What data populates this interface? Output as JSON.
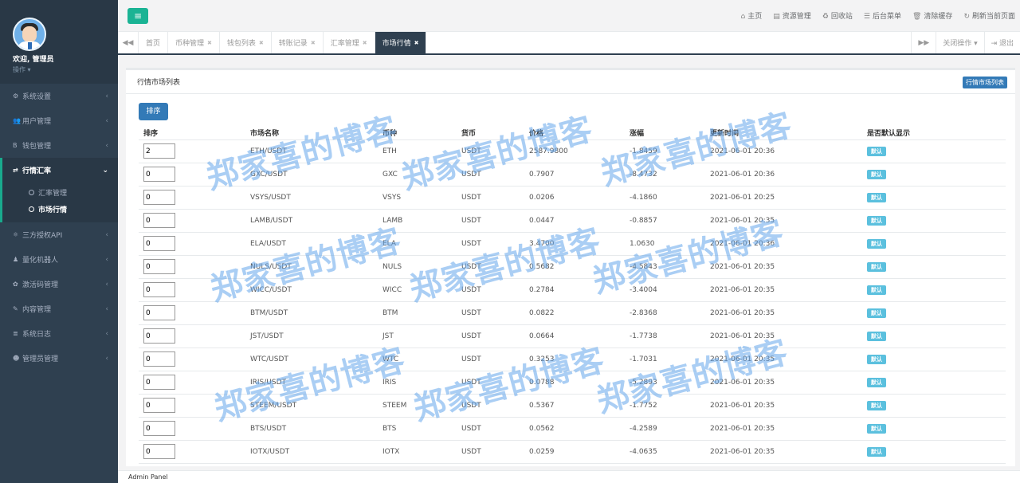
{
  "sidebar": {
    "welcome": "欢迎, 管理员",
    "ops": "操作 ▾",
    "items": [
      {
        "icon": "⚙",
        "label": "系统设置"
      },
      {
        "icon": "👥",
        "label": "用户管理"
      },
      {
        "icon": "B",
        "label": "钱包管理"
      },
      {
        "icon": "⇄",
        "label": "行情汇率"
      },
      {
        "icon": "⚛",
        "label": "三方授权API"
      },
      {
        "icon": "♟",
        "label": "量化机器人"
      },
      {
        "icon": "✿",
        "label": "激活码管理"
      },
      {
        "icon": "✎",
        "label": "内容管理"
      },
      {
        "icon": "≣",
        "label": "系统日志"
      },
      {
        "icon": "☻",
        "label": "管理员管理"
      }
    ],
    "sub_items": [
      {
        "label": "汇率管理"
      },
      {
        "label": "市场行情"
      }
    ]
  },
  "topbar": {
    "links": [
      {
        "icon": "⌂",
        "label": "主页"
      },
      {
        "icon": "▤",
        "label": "资源管理"
      },
      {
        "icon": "♻",
        "label": "回收站"
      },
      {
        "icon": "☰",
        "label": "后台菜单"
      },
      {
        "icon": "🗑",
        "label": "清除缓存"
      },
      {
        "icon": "↻",
        "label": "刷新当前页面"
      }
    ]
  },
  "tabs": {
    "items": [
      {
        "label": "首页"
      },
      {
        "label": "币种管理"
      },
      {
        "label": "钱包列表"
      },
      {
        "label": "转账记录"
      },
      {
        "label": "汇率管理"
      },
      {
        "label": "市场行情"
      }
    ],
    "close_ops": "关闭操作 ▾",
    "logout": "⇥ 退出"
  },
  "panel": {
    "title": "行情市场列表",
    "title_badge": "行情市场列表",
    "sort_button": "排序",
    "columns": [
      "排序",
      "市场名称",
      "币种",
      "货币",
      "价格",
      "涨幅",
      "更新时间",
      "是否默认显示"
    ],
    "rows": [
      {
        "sort": "2",
        "market": "ETH/USDT",
        "coin": "ETH",
        "currency": "USDT",
        "price": "2587.9800",
        "change": "-1.8459",
        "time": "2021-06-01 20:36",
        "default": "默认"
      },
      {
        "sort": "0",
        "market": "GXC/USDT",
        "coin": "GXC",
        "currency": "USDT",
        "price": "0.7907",
        "change": "-8.4732",
        "time": "2021-06-01 20:36",
        "default": "默认"
      },
      {
        "sort": "0",
        "market": "VSYS/USDT",
        "coin": "VSYS",
        "currency": "USDT",
        "price": "0.0206",
        "change": "-4.1860",
        "time": "2021-06-01 20:25",
        "default": "默认"
      },
      {
        "sort": "0",
        "market": "LAMB/USDT",
        "coin": "LAMB",
        "currency": "USDT",
        "price": "0.0447",
        "change": "-0.8857",
        "time": "2021-06-01 20:35",
        "default": "默认"
      },
      {
        "sort": "0",
        "market": "ELA/USDT",
        "coin": "ELA",
        "currency": "USDT",
        "price": "3.4700",
        "change": "1.0630",
        "time": "2021-06-01 20:36",
        "default": "默认"
      },
      {
        "sort": "0",
        "market": "NULS/USDT",
        "coin": "NULS",
        "currency": "USDT",
        "price": "0.5682",
        "change": "-4.5843",
        "time": "2021-06-01 20:35",
        "default": "默认"
      },
      {
        "sort": "0",
        "market": "WICC/USDT",
        "coin": "WICC",
        "currency": "USDT",
        "price": "0.2784",
        "change": "-3.4004",
        "time": "2021-06-01 20:35",
        "default": "默认"
      },
      {
        "sort": "0",
        "market": "BTM/USDT",
        "coin": "BTM",
        "currency": "USDT",
        "price": "0.0822",
        "change": "-2.8368",
        "time": "2021-06-01 20:35",
        "default": "默认"
      },
      {
        "sort": "0",
        "market": "JST/USDT",
        "coin": "JST",
        "currency": "USDT",
        "price": "0.0664",
        "change": "-1.7738",
        "time": "2021-06-01 20:35",
        "default": "默认"
      },
      {
        "sort": "0",
        "market": "WTC/USDT",
        "coin": "WTC",
        "currency": "USDT",
        "price": "0.3253",
        "change": "-1.7031",
        "time": "2021-06-01 20:35",
        "default": "默认"
      },
      {
        "sort": "0",
        "market": "IRIS/USDT",
        "coin": "IRIS",
        "currency": "USDT",
        "price": "0.0788",
        "change": "-5.2893",
        "time": "2021-06-01 20:35",
        "default": "默认"
      },
      {
        "sort": "0",
        "market": "STEEM/USDT",
        "coin": "STEEM",
        "currency": "USDT",
        "price": "0.5367",
        "change": "-1.7752",
        "time": "2021-06-01 20:35",
        "default": "默认"
      },
      {
        "sort": "0",
        "market": "BTS/USDT",
        "coin": "BTS",
        "currency": "USDT",
        "price": "0.0562",
        "change": "-4.2589",
        "time": "2021-06-01 20:35",
        "default": "默认"
      },
      {
        "sort": "0",
        "market": "IOTX/USDT",
        "coin": "IOTX",
        "currency": "USDT",
        "price": "0.0259",
        "change": "-4.0635",
        "time": "2021-06-01 20:35",
        "default": "默认"
      }
    ]
  },
  "footer": {
    "text": "Admin Panel"
  },
  "watermark": {
    "text": "郑家喜的博客"
  },
  "colors": {
    "sidebar": "#2f4050",
    "accent": "#1ab394",
    "primary": "#337ab7",
    "info": "#5bc0de"
  }
}
